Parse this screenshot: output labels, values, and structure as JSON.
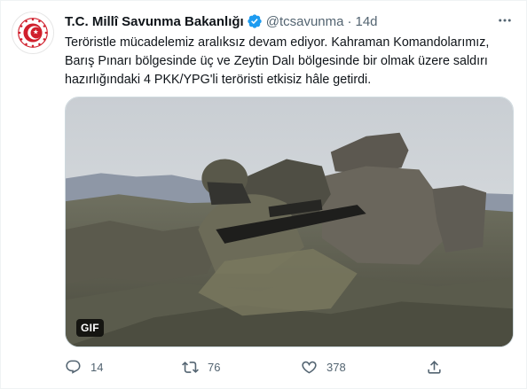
{
  "tweet": {
    "author": {
      "name": "T.C. Millî Savunma Bakanlığı",
      "handle": "@tcsavunma",
      "separator": "·",
      "time": "14d",
      "verified": true
    },
    "text_lines": [
      "Teröristle mücadelemiz aralıksız devam ediyor. Kahraman Komandolarımız,",
      "Barış Pınarı bölgesinde üç ve Zeytin Dalı bölgesinde bir olmak üzere saldırı",
      "hazırlığındaki 4 PKK/YPG'li teröristi etkisiz hâle getirdi."
    ],
    "media": {
      "badge": "GIF"
    },
    "actions": {
      "replies": "14",
      "retweets": "76",
      "likes": "378"
    },
    "colors": {
      "text": "#0f1419",
      "secondary": "#536471",
      "verified": "#1d9bf0",
      "logo_red": "#d0202d"
    },
    "icons": {
      "reply": "reply-icon",
      "retweet": "retweet-icon",
      "like": "heart-icon",
      "share": "share-icon",
      "more": "more-icon",
      "verified": "verified-badge-icon"
    }
  }
}
